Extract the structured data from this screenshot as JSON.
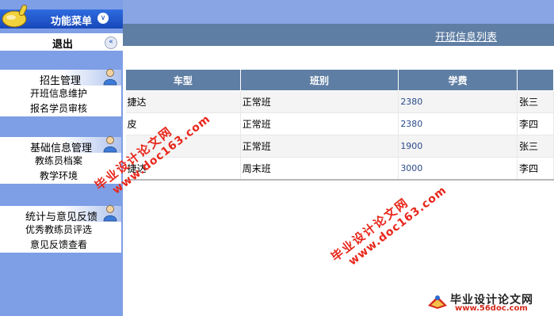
{
  "sidebar": {
    "menu_title": "功能菜单",
    "exit_label": "退出",
    "groups": [
      {
        "title": "招生管理",
        "items": [
          "开班信息维护",
          "报名学员审核"
        ]
      },
      {
        "title": "基础信息管理",
        "items": [
          "教练员档案",
          "教学环境"
        ]
      },
      {
        "title": "统计与意见反馈",
        "items": [
          "优秀教练员评选",
          "意见反馈查看"
        ]
      }
    ]
  },
  "main": {
    "page_title": "开班信息列表",
    "table": {
      "headers": [
        "车型",
        "班别",
        "学费",
        ""
      ],
      "rows": [
        [
          "捷达",
          "正常班",
          "2380",
          "张三"
        ],
        [
          "皮",
          "正常班",
          "2380",
          "李四"
        ],
        [
          "",
          "正常班",
          "1900",
          "张三"
        ],
        [
          "捷达",
          "周末班",
          "3000",
          "李四"
        ]
      ]
    }
  },
  "watermarks": {
    "line1": "毕业设计论文网",
    "line2": "www.doc163.com"
  },
  "footer": {
    "brand": "毕业设计论文网",
    "site": "www.56doc.com"
  },
  "colors": {
    "sidebar_bg": "#7e9ee6",
    "header_blue": "#5f7ea3",
    "watermark_red": "#e8271b"
  }
}
